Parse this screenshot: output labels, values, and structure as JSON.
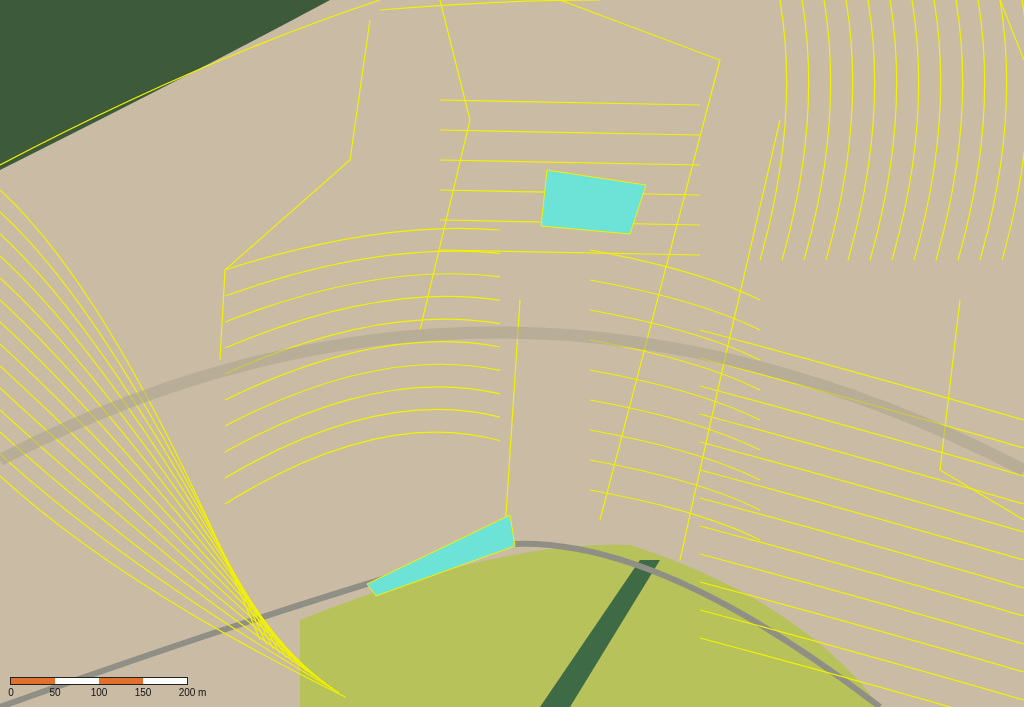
{
  "scale_bar": {
    "labels": [
      "0",
      "50",
      "100",
      "150",
      "200 m"
    ]
  }
}
